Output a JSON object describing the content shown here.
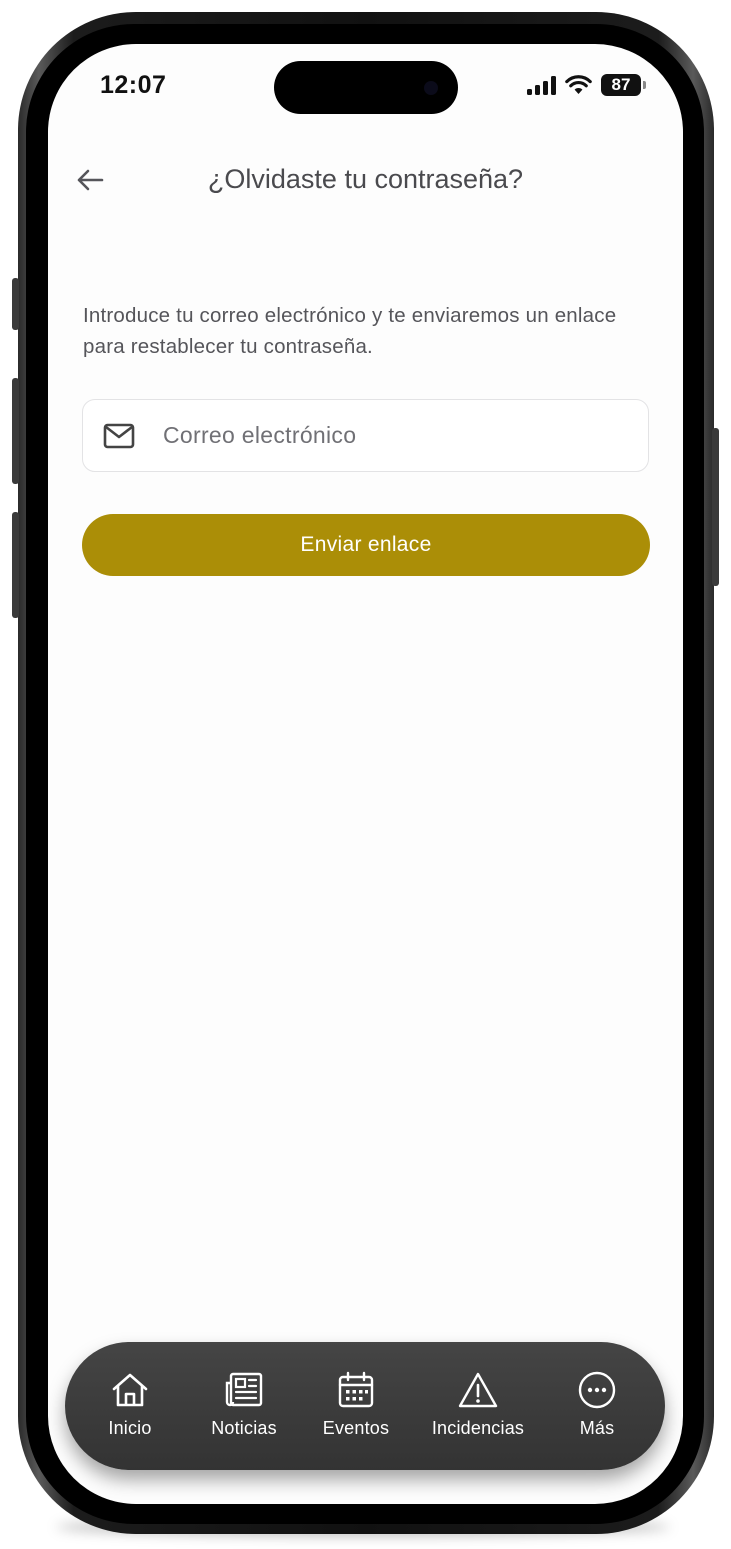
{
  "status_bar": {
    "time": "12:07",
    "battery": "87"
  },
  "header": {
    "title": "¿Olvidaste tu contraseña?",
    "back_icon": "arrow-left-icon"
  },
  "intro": {
    "text": "Introduce tu correo electrónico y te enviaremos un enlace para restablecer tu contraseña."
  },
  "email": {
    "placeholder": "Correo electrónico",
    "value": "",
    "icon": "mail-icon"
  },
  "submit": {
    "label": "Enviar enlace",
    "color": "#ab8e07"
  },
  "bottom_nav": {
    "items": [
      {
        "label": "Inicio",
        "icon": "home-icon"
      },
      {
        "label": "Noticias",
        "icon": "newspaper-icon"
      },
      {
        "label": "Eventos",
        "icon": "calendar-icon"
      },
      {
        "label": "Incidencias",
        "icon": "warning-icon"
      },
      {
        "label": "Más",
        "icon": "more-icon"
      }
    ]
  }
}
